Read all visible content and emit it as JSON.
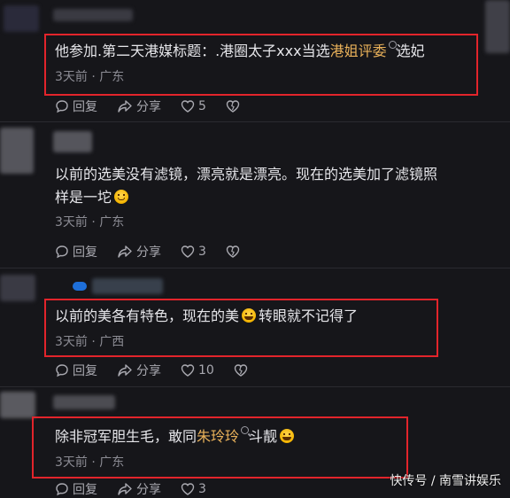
{
  "comments": [
    {
      "text_before": "他参加.第二天港媒标题：.港圈太子xxx当选",
      "text_highlight": "港姐评委",
      "text_after": "选妃",
      "meta": "3天前 · 广东",
      "reply": "回复",
      "share": "分享",
      "likes": "5"
    },
    {
      "text_line1": "以前的选美没有滤镜，漂亮就是漂亮。现在的选美加了滤镜照",
      "text_line2": "样是一坨",
      "meta": "3天前 · 广东",
      "reply": "回复",
      "share": "分享",
      "likes": "3"
    },
    {
      "text_before": "以前的美各有特色，现在的美",
      "text_after": "转眼就不记得了",
      "meta": "3天前 · 广西",
      "reply": "回复",
      "share": "分享",
      "likes": "10"
    },
    {
      "text_before": "除非冠军胆生毛，敢同",
      "text_highlight": "朱玲玲",
      "text_after": "斗靓",
      "meta": "3天前 · 广东",
      "reply": "回复",
      "share": "分享",
      "likes": "3"
    }
  ],
  "icons": [
    "comment-bubble-icon",
    "share-arrow-icon",
    "heart-icon",
    "broken-heart-icon",
    "search-icon",
    "laughing-emoji-icon",
    "smile-emoji-icon",
    "fish-badge-icon"
  ],
  "colors": {
    "background": "#16161a",
    "highlight": "#e9b15a",
    "annotation_box": "#e2242b"
  },
  "watermark": "快传号 / 南雪讲娱乐"
}
